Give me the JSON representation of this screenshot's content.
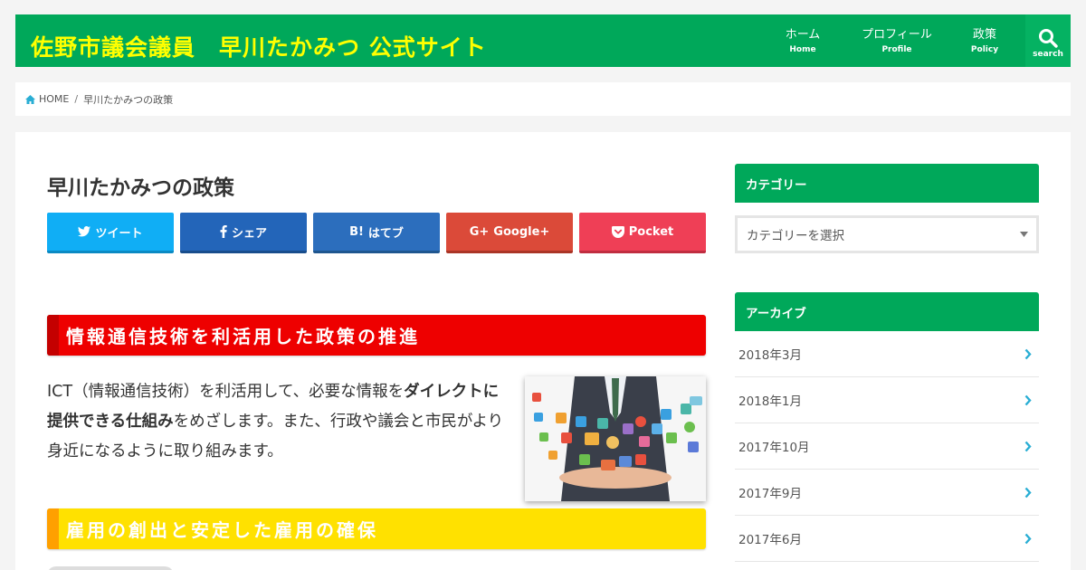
{
  "header": {
    "site_title": "佐野市議会議員　早川たかみつ 公式サイト",
    "nav": [
      {
        "label": "ホーム",
        "sub": "Home"
      },
      {
        "label": "プロフィール",
        "sub": "Profile"
      },
      {
        "label": "政策",
        "sub": "Policy"
      }
    ],
    "search_label": "search"
  },
  "breadcrumb": {
    "home": "HOME",
    "separator": "/",
    "current": "早川たかみつの政策"
  },
  "article": {
    "title": "早川たかみつの政策",
    "share": {
      "twitter": "ツイート",
      "facebook": "シェア",
      "hatena_icon": "B!",
      "hatena": "はてブ",
      "google_icon": "G+",
      "google": "Google+",
      "pocket": "Pocket"
    },
    "section1": {
      "heading": "情報通信技術を利活用した政策の推進",
      "text_a": "ICT（情報通信技術）を利活用して、必要な情報を",
      "text_b": "ダイレクトに提供できる仕組み",
      "text_c": "をめざします。また、行政や議会と市民がより身近になるように取り組みます。"
    },
    "section2": {
      "heading": "雇用の創出と安定した雇用の確保"
    }
  },
  "sidebar": {
    "category_title": "カテゴリー",
    "category_select": "カテゴリーを選択",
    "archive_title": "アーカイブ",
    "archives": [
      "2018年3月",
      "2018年1月",
      "2017年10月",
      "2017年9月",
      "2017年6月"
    ]
  },
  "colors": {
    "brand_green": "#00a85a",
    "title_yellow": "#ffff00",
    "heading_red": "#ee0000",
    "heading_yellow": "#ffe100",
    "accent_blue": "#2aaed4"
  }
}
